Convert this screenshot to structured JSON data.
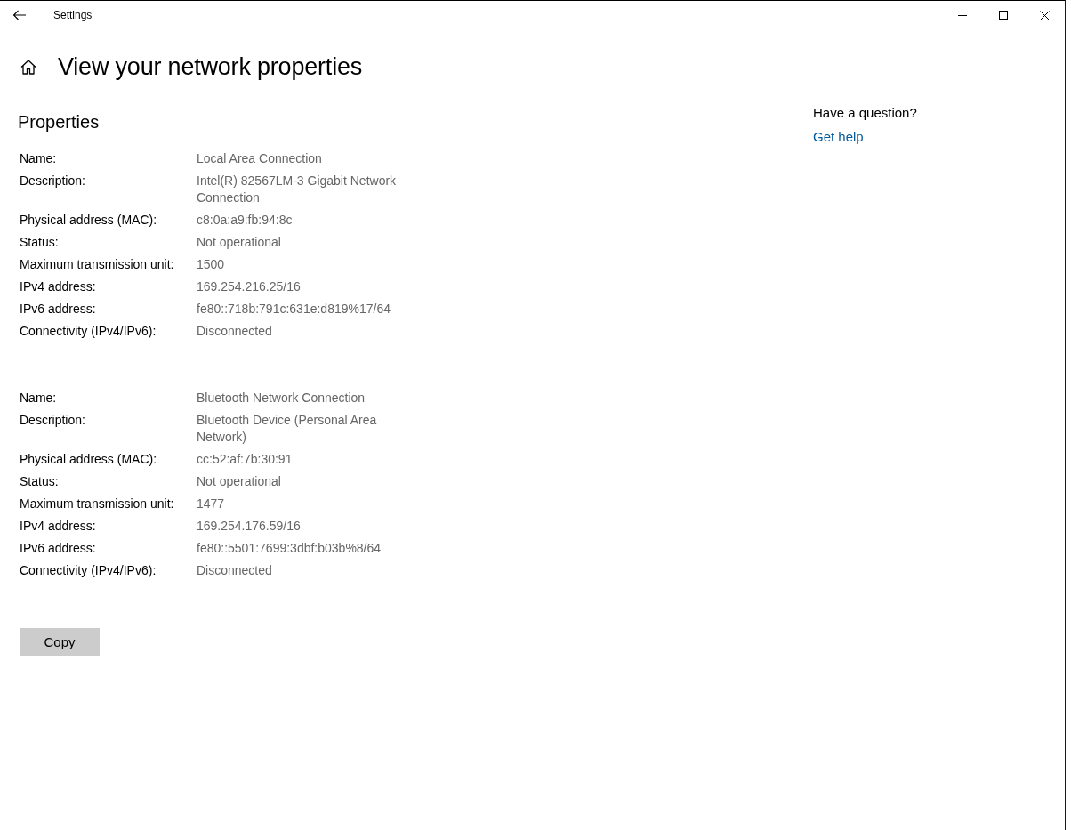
{
  "window": {
    "title": "Settings"
  },
  "page": {
    "title": "View your network properties"
  },
  "properties": {
    "heading": "Properties",
    "adapters": [
      {
        "fields": [
          {
            "label": "Name:",
            "value": "Local Area Connection"
          },
          {
            "label": "Description:",
            "value": "Intel(R) 82567LM-3 Gigabit Network Connection"
          },
          {
            "label": "Physical address (MAC):",
            "value": "c8:0a:a9:fb:94:8c"
          },
          {
            "label": "Status:",
            "value": "Not operational"
          },
          {
            "label": "Maximum transmission unit:",
            "value": "1500"
          },
          {
            "label": "IPv4 address:",
            "value": "169.254.216.25/16"
          },
          {
            "label": "IPv6 address:",
            "value": "fe80::718b:791c:631e:d819%17/64"
          },
          {
            "label": "Connectivity (IPv4/IPv6):",
            "value": "Disconnected"
          }
        ]
      },
      {
        "fields": [
          {
            "label": "Name:",
            "value": "Bluetooth Network Connection"
          },
          {
            "label": "Description:",
            "value": "Bluetooth Device (Personal Area Network)"
          },
          {
            "label": "Physical address (MAC):",
            "value": "cc:52:af:7b:30:91"
          },
          {
            "label": "Status:",
            "value": "Not operational"
          },
          {
            "label": "Maximum transmission unit:",
            "value": "1477"
          },
          {
            "label": "IPv4 address:",
            "value": "169.254.176.59/16"
          },
          {
            "label": "IPv6 address:",
            "value": "fe80::5501:7699:3dbf:b03b%8/64"
          },
          {
            "label": "Connectivity (IPv4/IPv6):",
            "value": "Disconnected"
          }
        ]
      }
    ]
  },
  "copy_button": {
    "label": "Copy"
  },
  "help": {
    "question": "Have a question?",
    "link": "Get help"
  }
}
